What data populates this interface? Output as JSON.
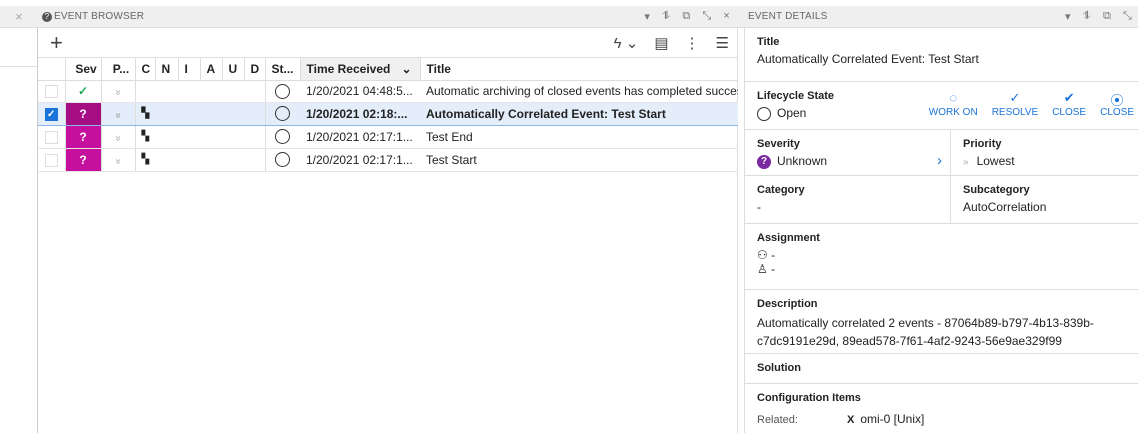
{
  "left_panel": {
    "close": "×"
  },
  "event_browser": {
    "title": "EVENT BROWSER",
    "header_controls": [
      "▾",
      "⥮",
      "⧉",
      "⤡",
      "×"
    ],
    "toolbar": {
      "add": "+",
      "lightning": "ϟ ⌄",
      "report": "▤",
      "more": "⋮",
      "menu": "☰"
    },
    "columns": [
      "",
      "Sev",
      "P...",
      "C",
      "N",
      "I",
      "A",
      "U",
      "D",
      "St...",
      "Time Received",
      "Title"
    ],
    "sort_icon": "⌄",
    "rows": [
      {
        "checked": false,
        "severity": "normal",
        "sev_label": "✓",
        "priority": "»",
        "ci": "",
        "state": "open",
        "time": "1/20/2021 04:48:5...",
        "title": "Automatic archiving of closed events has completed successfully"
      },
      {
        "checked": true,
        "severity": "unknown",
        "sev_label": "?",
        "priority": "»",
        "ci": "▚",
        "state": "open",
        "time": "1/20/2021 02:18:...",
        "title": "Automatically Correlated Event: Test Start"
      },
      {
        "checked": false,
        "severity": "unknown",
        "sev_label": "?",
        "priority": "»",
        "ci": "▚",
        "state": "open",
        "time": "1/20/2021 02:17:1...",
        "title": "Test End"
      },
      {
        "checked": false,
        "severity": "unknown",
        "sev_label": "?",
        "priority": "»",
        "ci": "▚",
        "state": "open",
        "time": "1/20/2021 02:17:1...",
        "title": "Test Start"
      }
    ]
  },
  "event_details": {
    "title": "EVENT DETAILS",
    "header_controls": [
      "▾",
      "⥮",
      "⧉",
      "⤡"
    ],
    "title_label": "Title",
    "title_value": "Automatically Correlated Event: Test Start",
    "lifecycle_label": "Lifecycle State",
    "lifecycle_value": "Open",
    "actions": [
      {
        "icon": "◌",
        "label": "WORK ON"
      },
      {
        "icon": "✓",
        "label": "RESOLVE"
      },
      {
        "icon": "✔",
        "label": "CLOSE"
      },
      {
        "icon": "⦿",
        "label": "CLOSE"
      }
    ],
    "severity_label": "Severity",
    "severity_value": "Unknown",
    "severity_chevron": "›",
    "priority_label": "Priority",
    "priority_value": "Lowest",
    "category_label": "Category",
    "category_value": "-",
    "subcategory_label": "Subcategory",
    "subcategory_value": "AutoCorrelation",
    "assignment_label": "Assignment",
    "group_value": "-",
    "user_value": "-",
    "description_label": "Description",
    "description_value": "Automatically correlated 2 events - 87064b89-b797-4b13-839b-c7dc9191e29d, 89ead578-7f61-4af2-9243-56e9ae329f99",
    "solution_label": "Solution",
    "ci_label": "Configuration Items",
    "related_label": "Related:",
    "related_value": "omi-0 [Unix]"
  },
  "colors": {
    "unknown_severity": "#c5109e",
    "accent": "#1a73d9",
    "normal": "#1aa85a"
  }
}
